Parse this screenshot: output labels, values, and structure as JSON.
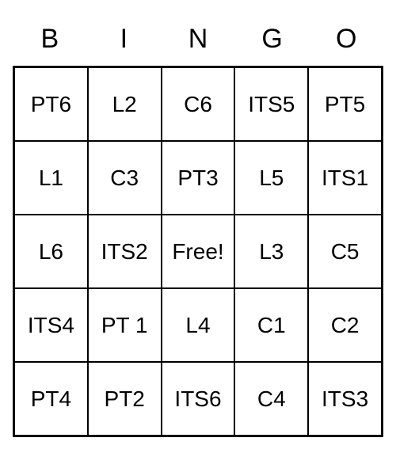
{
  "headers": [
    "B",
    "I",
    "N",
    "G",
    "O"
  ],
  "cells": {
    "r0c0": "PT6",
    "r0c1": "L2",
    "r0c2": "C6",
    "r0c3": "ITS5",
    "r0c4": "PT5",
    "r1c0": "L1",
    "r1c1": "C3",
    "r1c2": "PT3",
    "r1c3": "L5",
    "r1c4": "ITS1",
    "r2c0": "L6",
    "r2c1": "ITS2",
    "r2c2": "Free!",
    "r2c3": "L3",
    "r2c4": "C5",
    "r3c0": "ITS4",
    "r3c1": "PT 1",
    "r3c2": "L4",
    "r3c3": "C1",
    "r3c4": "C2",
    "r4c0": "PT4",
    "r4c1": "PT2",
    "r4c2": "ITS6",
    "r4c3": "C4",
    "r4c4": "ITS3"
  }
}
